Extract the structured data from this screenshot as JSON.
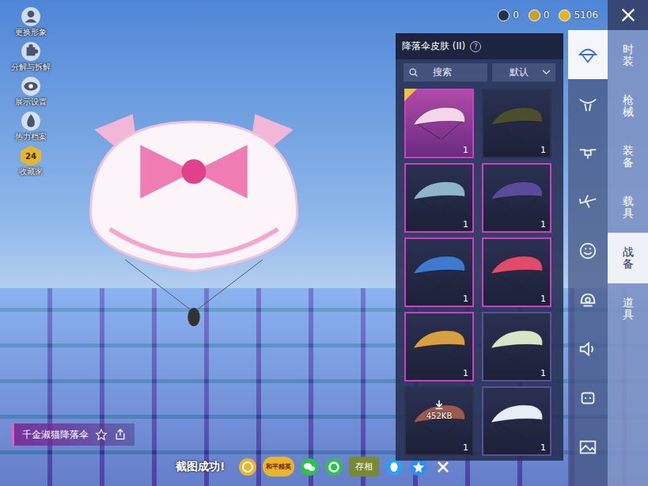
{
  "hud": [
    {
      "label": "更换形象",
      "kind": "avatar"
    },
    {
      "label": "分解与拆解",
      "kind": "puzzle"
    },
    {
      "label": "展示设置",
      "kind": "eye"
    },
    {
      "label": "热力档案",
      "kind": "flame"
    },
    {
      "label": "收藏家",
      "kind": "badge",
      "badge": "24"
    }
  ],
  "currencies": [
    {
      "value": "0",
      "color": "#26304a"
    },
    {
      "value": "0",
      "color": "#c9a02c"
    },
    {
      "value": "5106",
      "color": "#e2b426"
    }
  ],
  "panel": {
    "title": "降落伞皮肤 (II)",
    "help": "?",
    "search": {
      "placeholder": "搜索"
    },
    "sort": {
      "value": "默认"
    }
  },
  "items": [
    {
      "kind": "owned",
      "count": "1",
      "selected": true,
      "color": "#d23cc4",
      "canopy": "#f4d6e8"
    },
    {
      "kind": "owned",
      "count": "1",
      "selected": false,
      "color": "#2c3350",
      "canopy": "#4a4e2c"
    },
    {
      "kind": "owned",
      "count": "1",
      "selected": false,
      "color": "#d23cc4",
      "canopy": "#8fb6c8"
    },
    {
      "kind": "owned",
      "count": "1",
      "selected": false,
      "color": "#d23cc4",
      "canopy": "#5a4a9a"
    },
    {
      "kind": "owned",
      "count": "1",
      "selected": false,
      "color": "#d23cc4",
      "canopy": "#3d7ad0"
    },
    {
      "kind": "owned",
      "count": "1",
      "selected": false,
      "color": "#d23cc4",
      "canopy": "#e24a6a"
    },
    {
      "kind": "owned",
      "count": "1",
      "selected": false,
      "color": "#d23cc4",
      "canopy": "#d8a040"
    },
    {
      "kind": "owned",
      "count": "1",
      "selected": false,
      "color": "#5a4f9a",
      "canopy": "#d8e6c8"
    },
    {
      "kind": "download",
      "count": "1",
      "selected": false,
      "color": "#2c3350",
      "canopy": "#9a5a50",
      "size": "452KB"
    },
    {
      "kind": "owned",
      "count": "1",
      "selected": false,
      "color": "#5a4f9a",
      "canopy": "#e8eef8"
    }
  ],
  "icon_tabs": [
    {
      "kind": "parachute",
      "selected": true
    },
    {
      "kind": "glider",
      "selected": false
    },
    {
      "kind": "drone",
      "selected": false
    },
    {
      "kind": "plane",
      "selected": false
    },
    {
      "kind": "emote",
      "selected": false
    },
    {
      "kind": "helmet",
      "selected": false
    },
    {
      "kind": "sound",
      "selected": false
    },
    {
      "kind": "robot",
      "selected": false
    },
    {
      "kind": "photo",
      "selected": false
    }
  ],
  "tabs": [
    {
      "label": "时装",
      "selected": false
    },
    {
      "label": "枪械",
      "selected": false
    },
    {
      "label": "装备",
      "selected": false
    },
    {
      "label": "载具",
      "selected": false
    },
    {
      "label": "战备",
      "selected": true
    },
    {
      "label": "道具",
      "selected": false
    }
  ],
  "preview": {
    "name": "千金淑猫降落伞"
  },
  "toast": {
    "message": "截图成功!",
    "share": [
      {
        "kind": "coin"
      },
      {
        "kind": "game",
        "label": "和平精英"
      },
      {
        "kind": "wechat"
      },
      {
        "kind": "moments"
      },
      {
        "kind": "save",
        "label": "存相"
      },
      {
        "kind": "qq"
      },
      {
        "kind": "qzone"
      },
      {
        "kind": "close"
      }
    ]
  }
}
